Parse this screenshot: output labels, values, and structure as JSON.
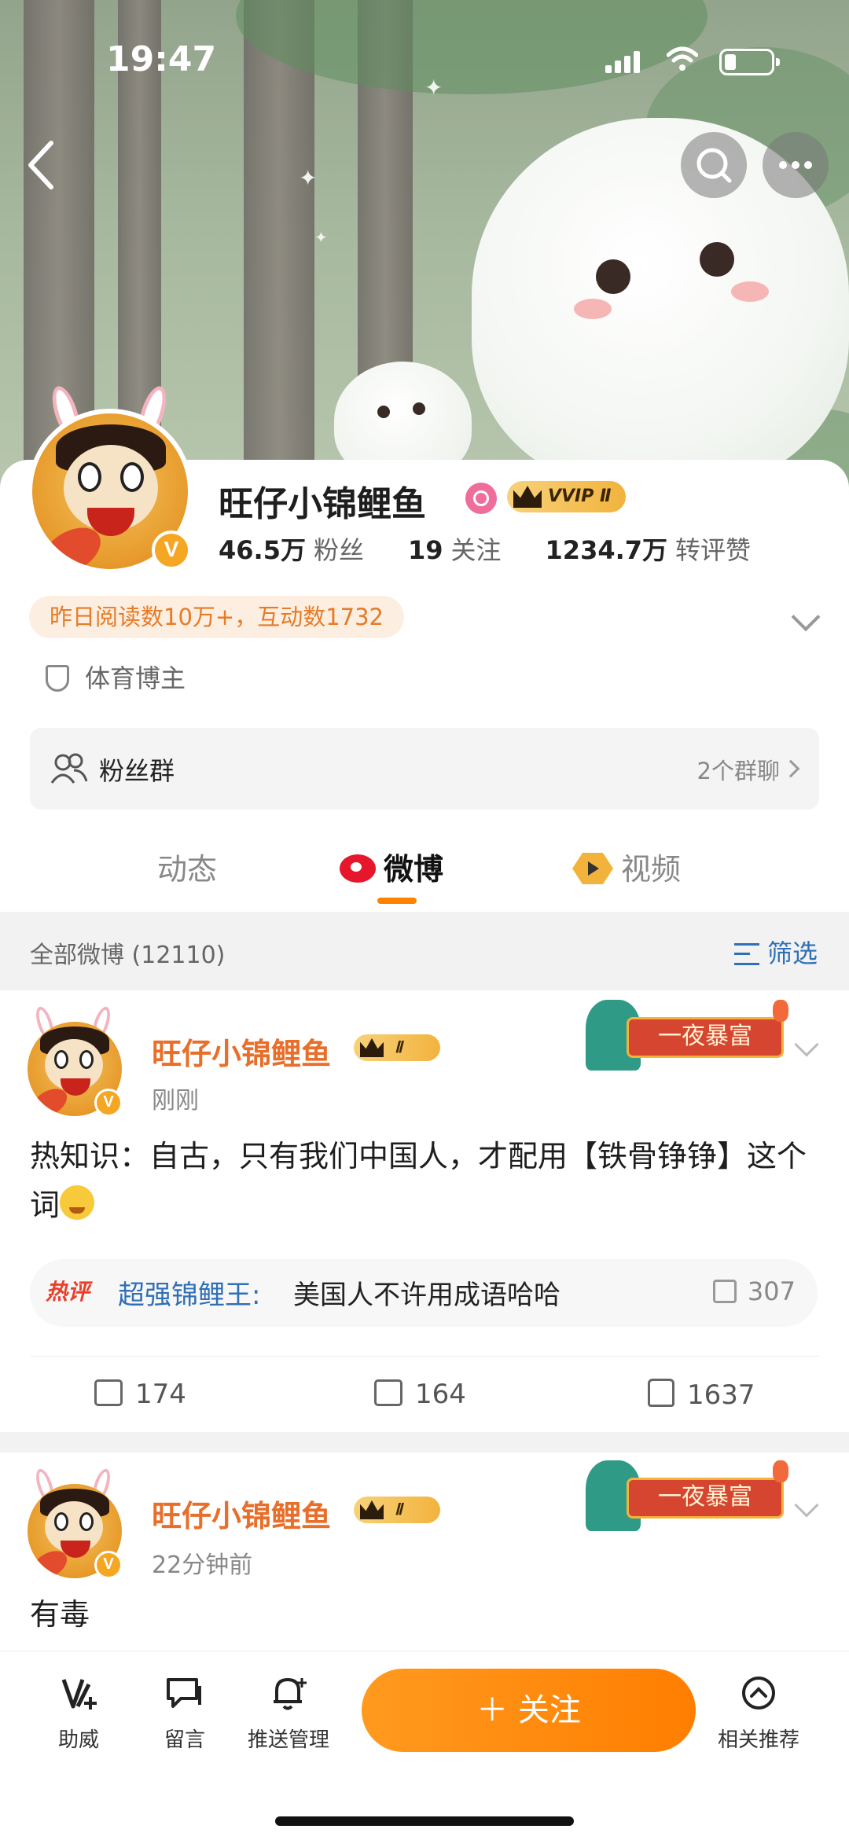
{
  "status_bar": {
    "time": "19:47"
  },
  "profile": {
    "name": "旺仔小锦鲤鱼",
    "vip_badge": "VVIP Ⅱ",
    "verified_mark": "V",
    "stats": {
      "followers_value": "46.5万",
      "followers_label": "粉丝",
      "following_value": "19",
      "following_label": "关注",
      "likes_value": "1234.7万",
      "likes_label": "转评赞"
    },
    "read_info": "昨日阅读数10万+，互动数1732",
    "category": "体育博主",
    "fan_group": {
      "label": "粉丝群",
      "right_text": "2个群聊"
    }
  },
  "tabs": [
    {
      "label": "动态",
      "active": false
    },
    {
      "label": "微博",
      "active": true
    },
    {
      "label": "视频",
      "active": false
    }
  ],
  "filter_bar": {
    "all_label": "全部微博 (12110)",
    "filter_label": "筛选"
  },
  "posts": [
    {
      "author": "旺仔小锦鲤鱼",
      "badge": "Ⅱ",
      "time": "刚刚",
      "decoration": "一夜暴富",
      "text": "热知识：自古，只有我们中国人，才配用【铁骨铮铮】这个词",
      "hot_comment": {
        "tag": "热评",
        "author": "超强锦鲤王:",
        "text": "美国人不许用成语哈哈",
        "likes": "307"
      },
      "actions": {
        "repost": "174",
        "comment": "164",
        "like": "1637"
      }
    },
    {
      "author": "旺仔小锦鲤鱼",
      "badge": "Ⅱ",
      "time": "22分钟前",
      "decoration": "一夜暴富",
      "text": "有毒"
    }
  ],
  "bottom_bar": {
    "items": [
      {
        "label": "助威",
        "icon": "cheer-icon"
      },
      {
        "label": "留言",
        "icon": "message-icon"
      },
      {
        "label": "推送管理",
        "icon": "bell-plus-icon"
      },
      {
        "label": "相关推荐",
        "icon": "chevron-up-circle-icon"
      }
    ],
    "follow_label": "＋ 关注"
  },
  "colors": {
    "accent": "#ff8200",
    "link_blue": "#2f6fb6",
    "name_orange": "#e86e2a",
    "hot_red": "#e8402a"
  }
}
